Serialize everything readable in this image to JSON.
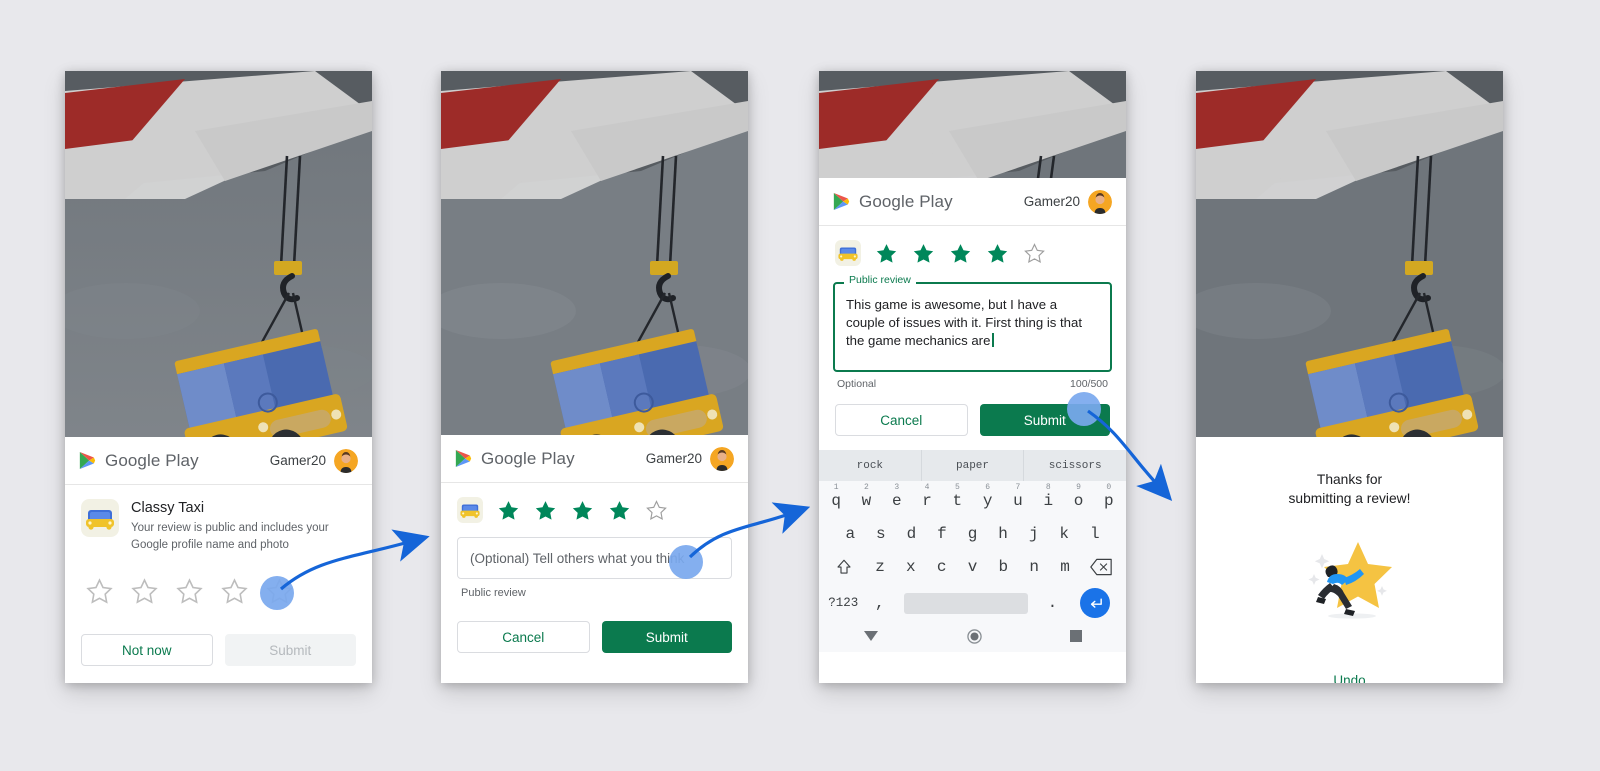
{
  "background_color": "#e8e8ec",
  "brand": {
    "play_label": "Google Play",
    "accent_green": "#0b7a4e",
    "accent_blue": "#1a73e8",
    "star_gold": "#f5c342"
  },
  "panels": [
    {
      "id": "panel-rating-empty",
      "header": {
        "app_name": "Google Play",
        "user": "Gamer20"
      },
      "app": {
        "name": "Classy Taxi",
        "description": "Your review is public and includes your Google profile name and photo"
      },
      "stars": {
        "filled": 0,
        "total": 5
      },
      "buttons": {
        "secondary": "Not now",
        "primary": "Submit",
        "primary_disabled": true
      }
    },
    {
      "id": "panel-rating-chosen",
      "header": {
        "app_name": "Google Play",
        "user": "Gamer20"
      },
      "stars": {
        "filled": 4,
        "total": 5
      },
      "input": {
        "placeholder": "(Optional) Tell others what you think",
        "value": "",
        "helper": "Public review"
      },
      "buttons": {
        "secondary": "Cancel",
        "primary": "Submit",
        "primary_disabled": false
      }
    },
    {
      "id": "panel-review-typing",
      "header": {
        "app_name": "Google Play",
        "user": "Gamer20"
      },
      "stars": {
        "filled": 4,
        "total": 5
      },
      "textarea": {
        "legend": "Public review",
        "value": "This game is awesome, but I have a couple of issues with it. First thing is that the game mechanics are",
        "helper": "Optional",
        "counter": "100/500"
      },
      "buttons": {
        "secondary": "Cancel",
        "primary": "Submit",
        "primary_disabled": false
      },
      "keyboard": {
        "suggestions": [
          "rock",
          "paper",
          "scissors"
        ],
        "row1": [
          {
            "key": "q",
            "num": "1"
          },
          {
            "key": "w",
            "num": "2"
          },
          {
            "key": "e",
            "num": "3"
          },
          {
            "key": "r",
            "num": "4"
          },
          {
            "key": "t",
            "num": "5"
          },
          {
            "key": "y",
            "num": "6"
          },
          {
            "key": "u",
            "num": "7"
          },
          {
            "key": "i",
            "num": "8"
          },
          {
            "key": "o",
            "num": "9"
          },
          {
            "key": "p",
            "num": "0"
          }
        ],
        "row2": [
          "a",
          "s",
          "d",
          "f",
          "g",
          "h",
          "j",
          "k",
          "l"
        ],
        "row3": [
          "z",
          "x",
          "c",
          "v",
          "b",
          "n",
          "m"
        ],
        "shift_key": "shift",
        "backspace_key": "backspace",
        "symbols_key": "?123",
        "comma_key": ",",
        "period_key": ".",
        "space_key": "space",
        "enter_key": "enter"
      },
      "navbar": {
        "back": "down-triangle",
        "home": "circle",
        "recents": "square"
      }
    },
    {
      "id": "panel-thanks",
      "thanks_line1": "Thanks for",
      "thanks_line2": "submitting a review!",
      "undo_label": "Undo"
    }
  ],
  "annotations": {
    "arrow1": "tap 4th star leads to panel 2",
    "arrow2": "tap review field leads to panel 3",
    "arrow3": "tap Submit leads to panel 4"
  }
}
